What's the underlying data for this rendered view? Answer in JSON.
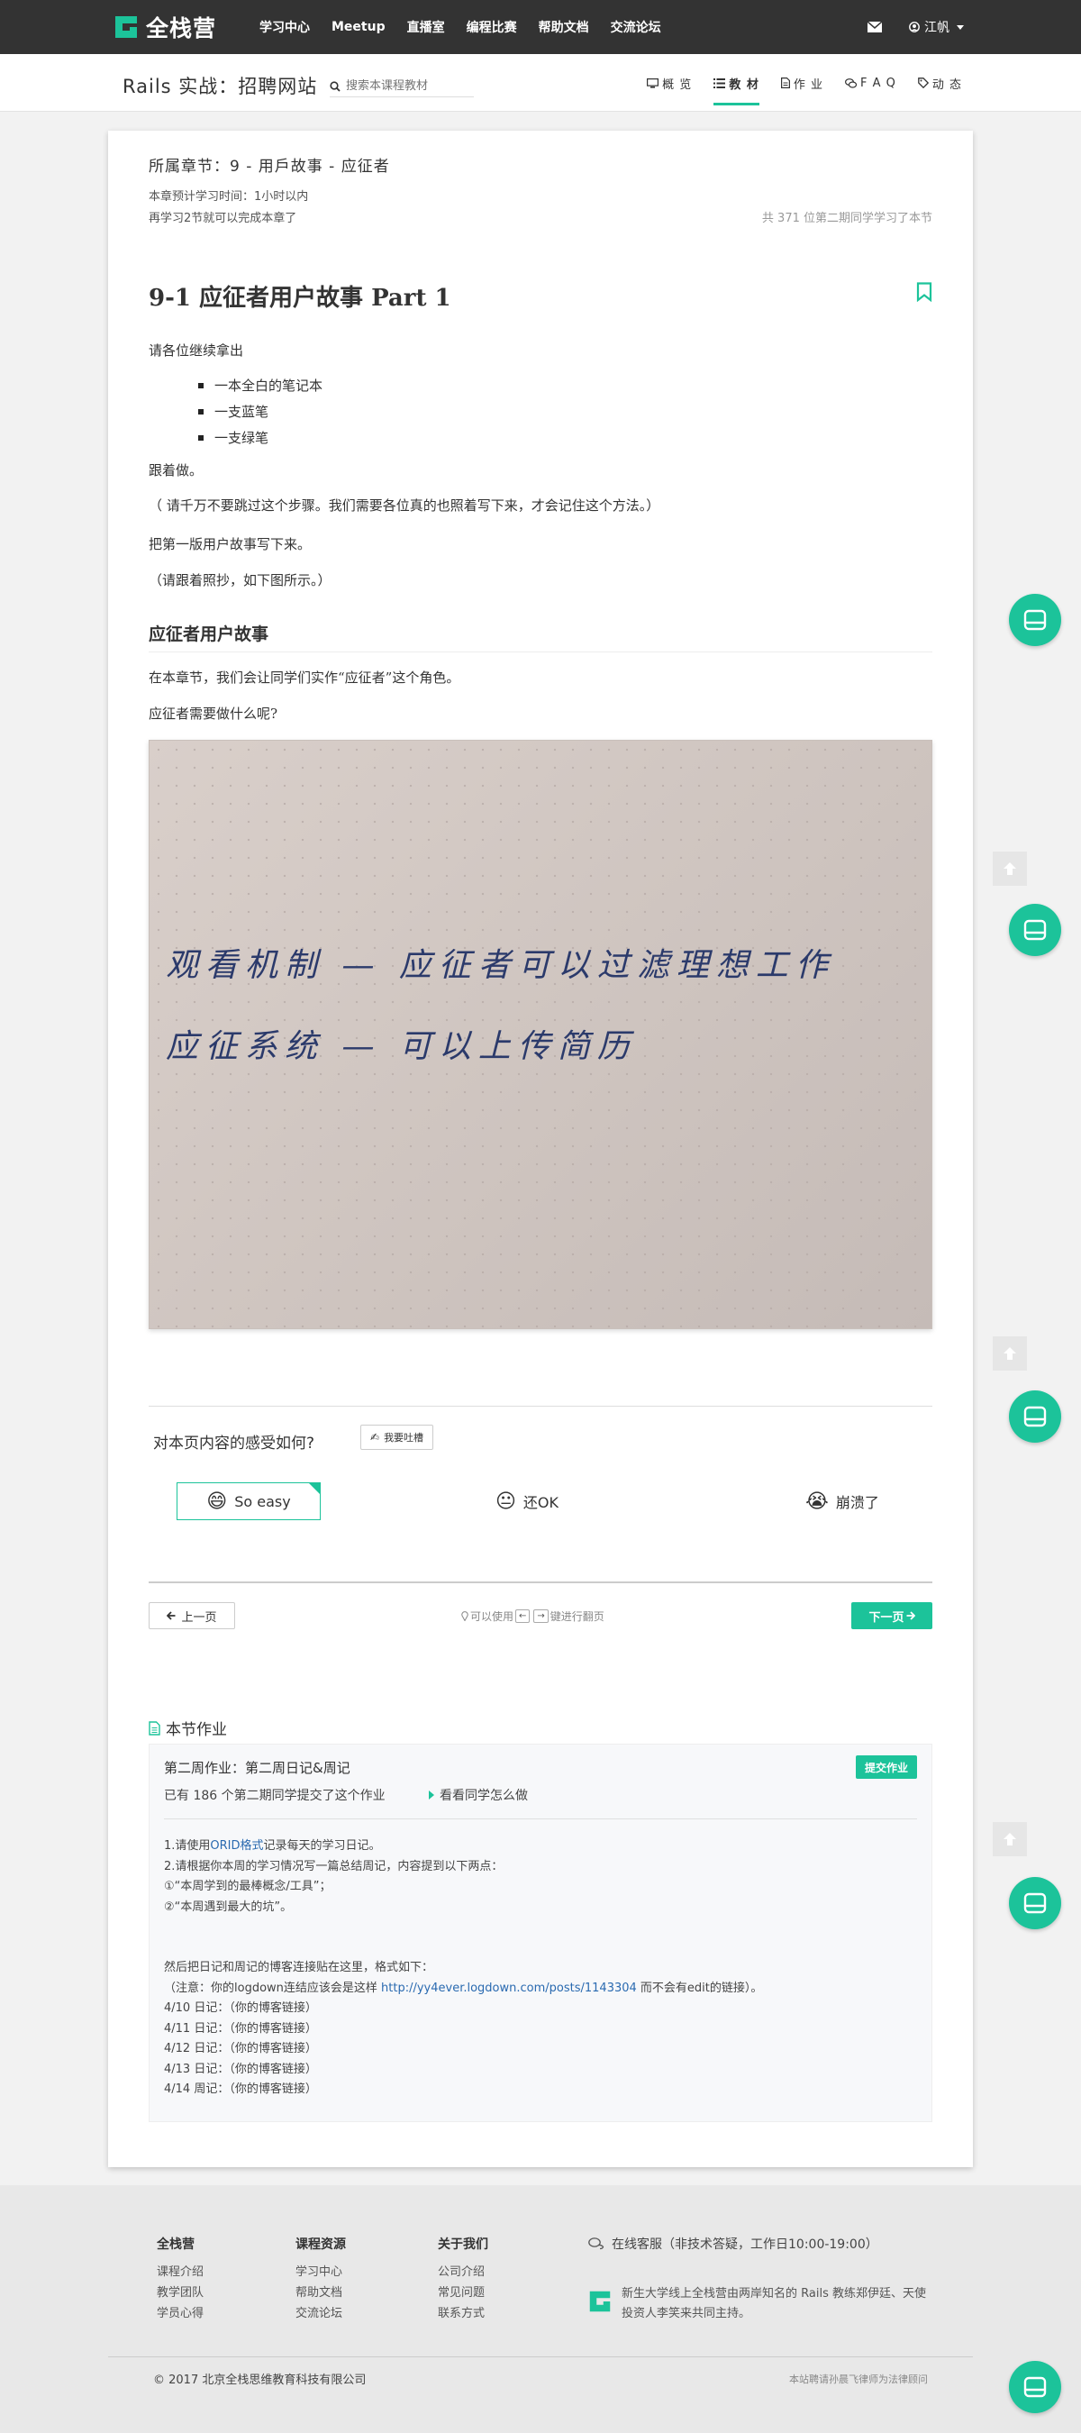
{
  "navbar": {
    "brand": "全栈营",
    "links": [
      "学习中心",
      "Meetup",
      "直播室",
      "编程比赛",
      "帮助文档",
      "交流论坛"
    ],
    "user": "江帆"
  },
  "subbar": {
    "course_title": "Rails 实战：招聘网站",
    "search_placeholder": "搜索本课程教材",
    "tabs": [
      "概 览",
      "教 材",
      "作 业",
      "F A Q",
      "动 态"
    ]
  },
  "chapter": {
    "belongs": "所属章节：9 - 用戶故事 - 应征者",
    "est_time": "本章预计学习时间：1小时以内",
    "remaining": "再学习2节就可以完成本章了",
    "studied": "共 371 位第二期同学学习了本节"
  },
  "lesson": {
    "title": "9-1 应征者用户故事 Part 1",
    "p1": "请各位继续拿出",
    "list": [
      "一本全白的笔记本",
      "一支蓝笔",
      "一支绿笔"
    ],
    "p2": "跟着做。",
    "p3": "（ 请千万不要跳过这个步骤。我们需要各位真的也照着写下来，才会记住这个方法。）",
    "p4": "把第一版用户故事写下来。",
    "p5": "（请跟着照抄，如下图所示。）",
    "h3": "应征者用户故事",
    "p6": "在本章节，我们会让同学们实作“应征者”这个角色。",
    "p7": "应征者需要做什么呢?",
    "photo_line1": "观看机制 — 应征者可以过滤理想工作",
    "photo_line2": "应征系统 — 可以上传简历"
  },
  "feedback": {
    "question": "对本页内容的感受如何?",
    "complain": "我要吐槽",
    "options": [
      {
        "emoji": "😄",
        "label": "So easy"
      },
      {
        "emoji": "😐",
        "label": "还OK"
      },
      {
        "emoji": "😭",
        "label": "崩溃了"
      }
    ]
  },
  "pager": {
    "prev": "上一页",
    "hint_pre": "可以使用",
    "hint_key_left": "←",
    "hint_key_right": "→",
    "hint_post": "键进行翻页",
    "next": "下一页"
  },
  "homework": {
    "section_title": "本节作业",
    "title": "第二周作业：第二周日记&周记",
    "submit": "提交作业",
    "submitted": "已有 186 个第二期同学提交了这个作业",
    "see_how": "看看同学怎么做",
    "line1_pre": "1.请使用",
    "line1_link": "ORID格式",
    "line1_post": "记录每天的学习日记。",
    "line2": "2.请根据你本周的学习情况写一篇总结周记，内容提到以下两点：",
    "line3": "①“本周学到的最棒概念/工具”；",
    "line4": "②“本周遇到最大的坑”。",
    "line5": "然后把日记和周记的博客连接贴在这里，格式如下：",
    "line6_pre": "（注意：你的logdown连结应该会是这样 ",
    "line6_link": "http://yy4ever.logdown.com/posts/1143304",
    "line6_post": " 而不会有edit的链接）。",
    "entries": [
      "4/10 日记：（你的博客链接）",
      "4/11 日记：（你的博客链接）",
      "4/12 日记：（你的博客链接）",
      "4/13 日记：（你的博客链接）",
      "4/14 周记：（你的博客链接）"
    ]
  },
  "footer": {
    "col1": {
      "title": "全栈营",
      "items": [
        "课程介绍",
        "教学团队",
        "学员心得"
      ]
    },
    "col2": {
      "title": "课程资源",
      "items": [
        "学习中心",
        "帮助文档",
        "交流论坛"
      ]
    },
    "col3": {
      "title": "关于我们",
      "items": [
        "公司介绍",
        "常见问题",
        "联系方式"
      ]
    },
    "service": "在线客服（非技术答疑，工作日10:00-19:00）",
    "desc": "新生大学线上全栈营由两岸知名的 Rails 教练郑伊廷、天使投资人李笑来共同主持。",
    "copyright": "© 2017 北京全栈思维教育科技有限公司",
    "legal": "本站聘请孙晨飞律师为法律顾问"
  },
  "colors": {
    "accent": "#1cc39a",
    "navbar": "#333333",
    "link": "#2a6ab0"
  }
}
